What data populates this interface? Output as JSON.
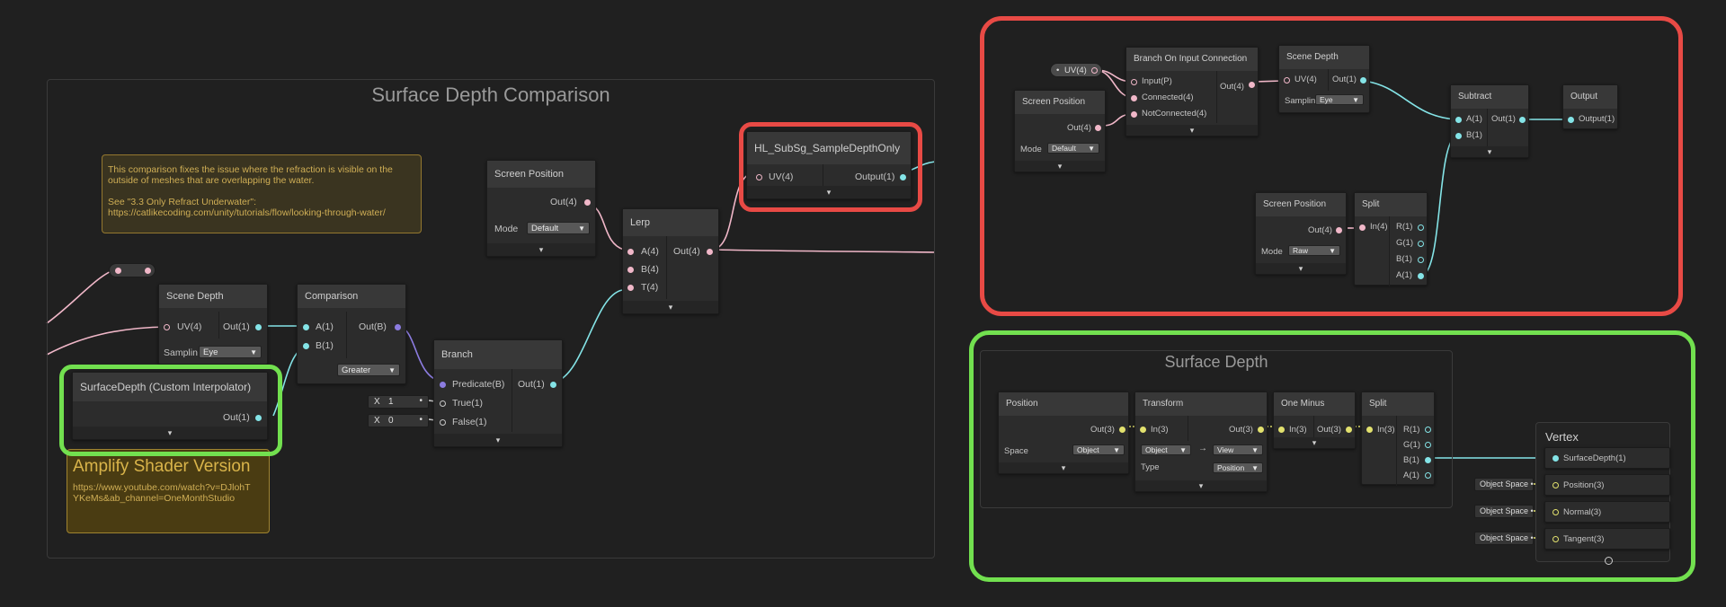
{
  "groups": {
    "surface_depth_comparison": "Surface Depth Comparison",
    "surface_depth": "Surface Depth"
  },
  "notes": {
    "refraction_note": {
      "line1": "This comparison fixes the issue where the refraction is visible on the",
      "line2": "outside of meshes that are overlapping the water.",
      "line3": "See \"3.3 Only Refract Underwater\":",
      "line4": "https://catlikecoding.com/unity/tutorials/flow/looking-through-water/"
    },
    "amplify_note": {
      "title": "Amplify Shader Version",
      "line1": "https://www.youtube.com/watch?v=DJlohT",
      "line2": "YKeMs&ab_channel=OneMonthStudio"
    }
  },
  "left": {
    "scene_depth": {
      "title": "Scene Depth",
      "in": "UV(4)",
      "out": "Out(1)",
      "sampling_label": "Samplin",
      "sampling": "Eye"
    },
    "comparison": {
      "title": "Comparison",
      "in_a": "A(1)",
      "in_b": "B(1)",
      "out": "Out(B)",
      "mode": "Greater"
    },
    "surface_depth_ci": {
      "title": "SurfaceDepth (Custom Interpolator)",
      "out": "Out(1)"
    },
    "branch": {
      "title": "Branch",
      "pred": "Predicate(B)",
      "true": "True(1)",
      "false": "False(1)",
      "out": "Out(1)",
      "x_true": "X",
      "v_true": "1",
      "x_false": "X",
      "v_false": "0"
    },
    "screen_position": {
      "title": "Screen Position",
      "out": "Out(4)",
      "mode_label": "Mode",
      "mode": "Default"
    },
    "lerp": {
      "title": "Lerp",
      "a": "A(4)",
      "b": "B(4)",
      "t": "T(4)",
      "out": "Out(4)"
    },
    "subgraph": {
      "title": "HL_SubSg_SampleDepthOnly",
      "in": "UV(4)",
      "out": "Output(1)"
    }
  },
  "right_top": {
    "uv_pill": "UV(4)",
    "screen_position": {
      "title": "Screen Position",
      "out": "Out(4)",
      "mode_label": "Mode",
      "mode": "Default"
    },
    "branch_input": {
      "title": "Branch On Input Connection",
      "input": "Input(P)",
      "connected": "Connected(4)",
      "not_connected": "NotConnected(4)",
      "out": "Out(4)"
    },
    "scene_depth": {
      "title": "Scene Depth",
      "in": "UV(4)",
      "out": "Out(1)",
      "sampling_label": "Samplin",
      "sampling": "Eye"
    },
    "subtract": {
      "title": "Subtract",
      "a": "A(1)",
      "b": "B(1)",
      "out": "Out(1)"
    },
    "output": {
      "title": "Output",
      "in": "Output(1)"
    },
    "screen_position_raw": {
      "title": "Screen Position",
      "out": "Out(4)",
      "mode_label": "Mode",
      "mode": "Raw"
    },
    "split": {
      "title": "Split",
      "in": "In(4)",
      "r": "R(1)",
      "g": "G(1)",
      "b": "B(1)",
      "a": "A(1)"
    }
  },
  "right_bottom": {
    "position": {
      "title": "Position",
      "out": "Out(3)",
      "space_label": "Space",
      "space": "Object"
    },
    "transform": {
      "title": "Transform",
      "in": "In(3)",
      "out": "Out(3)",
      "from": "Object",
      "arrow": "→",
      "to": "View",
      "type_label": "Type",
      "type": "Position"
    },
    "one_minus": {
      "title": "One Minus",
      "in": "In(3)",
      "out": "Out(3)"
    },
    "split": {
      "title": "Split",
      "in": "In(3)",
      "r": "R(1)",
      "g": "G(1)",
      "b": "B(1)",
      "a": "A(1)"
    },
    "vertex": {
      "title": "Vertex",
      "surface_depth": "SurfaceDepth(1)",
      "position": "Position(3)",
      "normal": "Normal(3)",
      "tangent": "Tangent(3)"
    },
    "object_space": "Object Space"
  },
  "colors": {
    "red_highlight": "#e84a45",
    "green_highlight": "#72e04f",
    "float_wire": "#84e4e7",
    "vector_wire": "#f0b7c8",
    "bool_wire": "#8c7ce0",
    "vec3_wire": "#e2e16e"
  }
}
